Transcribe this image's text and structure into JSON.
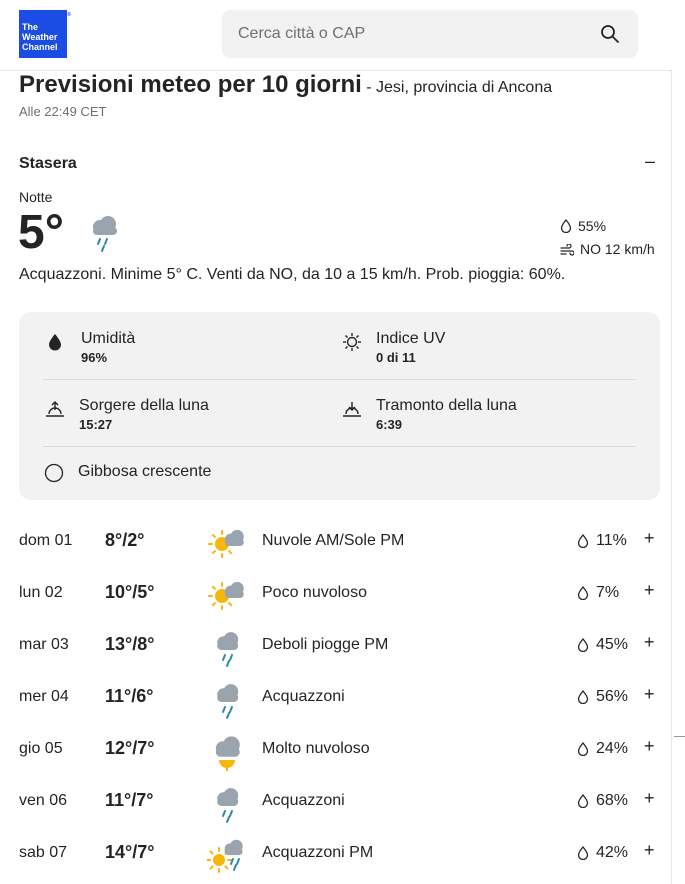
{
  "brand": {
    "logo_line1": "The",
    "logo_line2": "Weather",
    "logo_line3": "Channel",
    "logo_mark": "®",
    "color": "#1b4de4"
  },
  "search": {
    "placeholder": "Cerca città o CAP",
    "icon": "search-icon"
  },
  "header": {
    "title": "Previsioni meteo per 10 giorni",
    "location": "- Jesi, provincia di Ancona",
    "timestamp": "Alle 22:49 CET"
  },
  "tonight": {
    "section_title": "Stasera",
    "collapse_label": "–",
    "daypart": "Notte",
    "temp": "5°",
    "icon": "rain-showers-icon",
    "humidity": "55%",
    "wind": "NO 12 km/h",
    "narrative": "Acquazzoni. Minime 5° C. Venti da NO, da 10 a 15 km/h. Prob. pioggia: 60%."
  },
  "details": {
    "humidity_label": "Umidità",
    "humidity_value": "96%",
    "uv_label": "Indice UV",
    "uv_value": "0 di 11",
    "moonrise_label": "Sorgere della luna",
    "moonrise_value": "15:27",
    "moonset_label": "Tramonto della luna",
    "moonset_value": "6:39",
    "moon_phase": "Gibbosa crescente"
  },
  "days": [
    {
      "date": "dom 01",
      "temp": "8°/2°",
      "icon": "partly-cloudy-day-icon",
      "condition": "Nuvole AM/Sole PM",
      "precip": "11%"
    },
    {
      "date": "lun 02",
      "temp": "10°/5°",
      "icon": "partly-cloudy-day-icon",
      "condition": "Poco nuvoloso",
      "precip": "7%"
    },
    {
      "date": "mar 03",
      "temp": "13°/8°",
      "icon": "rain-showers-icon",
      "condition": "Deboli piogge PM",
      "precip": "45%"
    },
    {
      "date": "mer 04",
      "temp": "11°/6°",
      "icon": "rain-showers-icon",
      "condition": "Acquazzoni",
      "precip": "56%"
    },
    {
      "date": "gio 05",
      "temp": "12°/7°",
      "icon": "mostly-cloudy-icon",
      "condition": "Molto nuvoloso",
      "precip": "24%"
    },
    {
      "date": "ven 06",
      "temp": "11°/7°",
      "icon": "rain-showers-icon",
      "condition": "Acquazzoni",
      "precip": "68%"
    },
    {
      "date": "sab 07",
      "temp": "14°/7°",
      "icon": "sun-showers-icon",
      "condition": "Acquazzoni PM",
      "precip": "42%"
    }
  ],
  "expand_label": "+",
  "colors": {
    "sun": "#f5b70a",
    "cloud": "#9aa4ae",
    "rain": "#2b8aa6",
    "text": "#252422",
    "muted": "#6f6f6f",
    "panel": "#f2f2f2"
  }
}
